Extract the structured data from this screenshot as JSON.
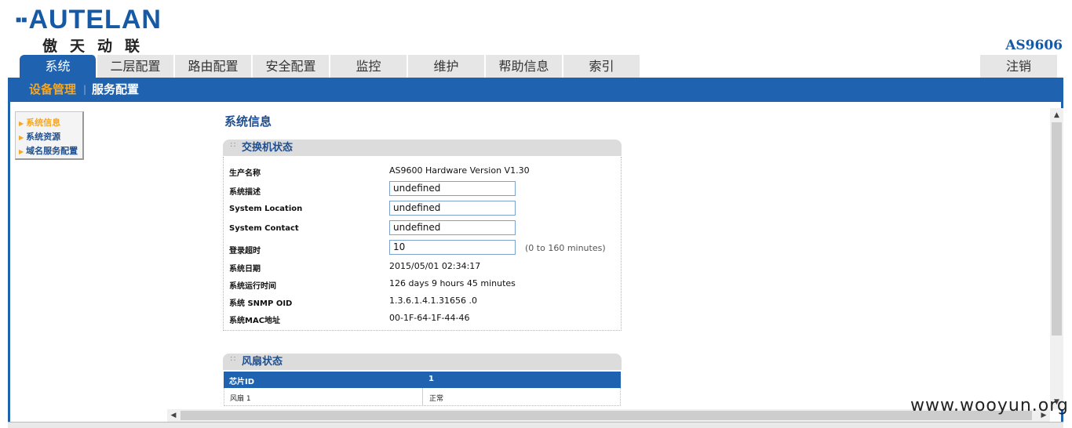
{
  "header": {
    "logo_text": "AUTELAN",
    "logo_cn": "傲天动联",
    "model": "AS9606"
  },
  "nav": {
    "tabs": [
      "系统",
      "二层配置",
      "路由配置",
      "安全配置",
      "监控",
      "维护",
      "帮助信息",
      "索引"
    ],
    "active_index": 0,
    "logout": "注销"
  },
  "subnav": {
    "items": [
      "设备管理",
      "服务配置"
    ],
    "separator": "|",
    "active_index": 0
  },
  "leftmenu": {
    "items": [
      "系统信息",
      "系统资源",
      "域名服务配置"
    ],
    "active_index": 0
  },
  "page_title": "系统信息",
  "switch_status": {
    "title": "交换机状态",
    "rows": [
      {
        "label": "生产名称",
        "value": "AS9600 Hardware Version V1.30"
      },
      {
        "label": "系统描述",
        "input": "undefined"
      },
      {
        "label": "System Location",
        "input": "undefined"
      },
      {
        "label": "System Contact",
        "input": "undefined"
      },
      {
        "label": "登录超时",
        "input": "10",
        "hint": "(0 to 160 minutes)"
      },
      {
        "label": "系统日期",
        "value": "2015/05/01 02:34:17"
      },
      {
        "label": "系统运行时间",
        "value": "126 days 9 hours 45 minutes"
      },
      {
        "label": "系统 SNMP OID",
        "value": "1.3.6.1.4.1.31656 .0"
      },
      {
        "label": "系统MAC地址",
        "value": "00-1F-64-1F-44-46"
      }
    ]
  },
  "fan_status": {
    "title": "风扇状态",
    "headers": [
      "芯片ID",
      "1"
    ],
    "rows": [
      [
        "风扇 1",
        "正常"
      ]
    ]
  },
  "watermark": "www.wooyun.org",
  "colors": {
    "accent_blue": "#1f62b0",
    "highlight_orange": "#f5a623",
    "title_blue": "#1f4f8f"
  }
}
